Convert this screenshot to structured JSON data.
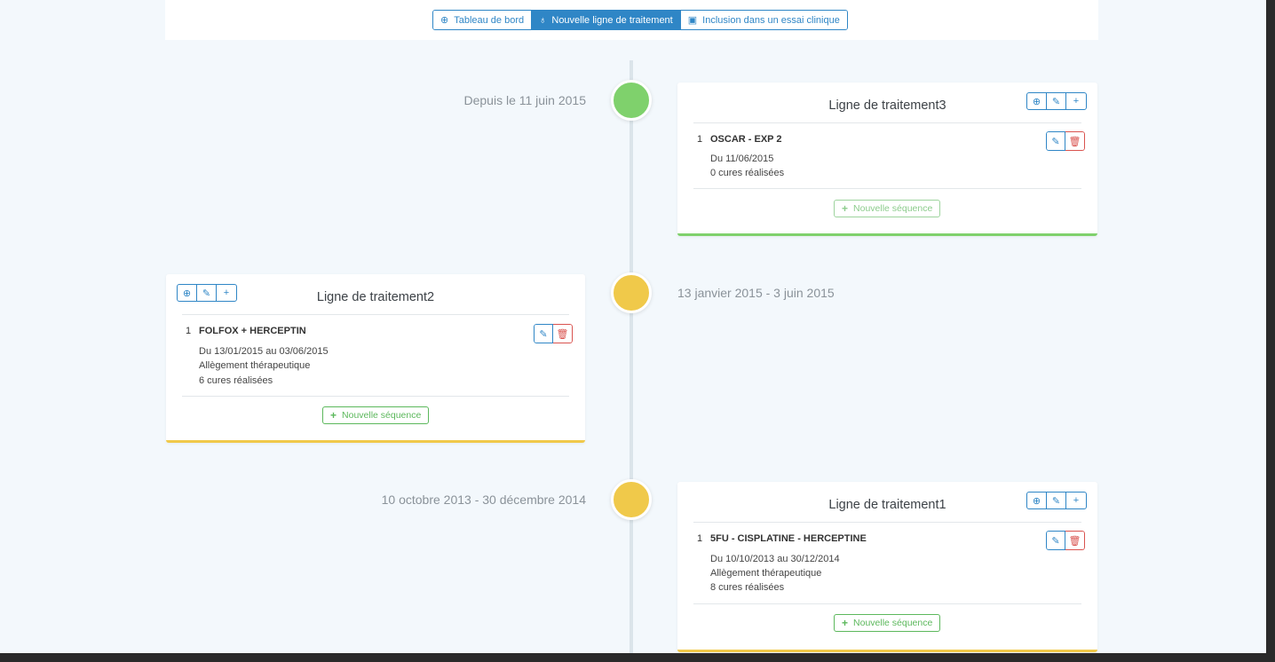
{
  "nav": {
    "tabs": [
      {
        "label": "Tableau de bord",
        "icon": "dashboard-icon"
      },
      {
        "label": "Nouvelle ligne de traitement",
        "icon": "stethoscope-icon"
      },
      {
        "label": "Inclusion dans un essai clinique",
        "icon": "medkit-icon"
      }
    ],
    "active_tab": 1
  },
  "timeline": [
    {
      "date": "Depuis le 11 juin 2015",
      "status_color": "#7fd16c",
      "title": "Ligne de traitement3",
      "sequences": [
        {
          "index": "1",
          "name": "OSCAR - EXP 2",
          "lines": [
            "Du 11/06/2015",
            "0 cures réalisées"
          ]
        }
      ],
      "new_sequence_label": "Nouvelle séquence"
    },
    {
      "date": "13 janvier 2015 - 3 juin 2015",
      "status_color": "#f0c94a",
      "title": "Ligne de traitement2",
      "sequences": [
        {
          "index": "1",
          "name": "FOLFOX + HERCEPTIN",
          "lines": [
            "Du 13/01/2015 au 03/06/2015",
            "Allègement thérapeutique",
            "6 cures réalisées"
          ]
        }
      ],
      "new_sequence_label": "Nouvelle séquence"
    },
    {
      "date": "10 octobre 2013 - 30 décembre 2014",
      "status_color": "#f0c94a",
      "title": "Ligne de traitement1",
      "sequences": [
        {
          "index": "1",
          "name": "5FU - CISPLATINE - HERCEPTINE",
          "lines": [
            "Du 10/10/2013 au 30/12/2014",
            "Allègement thérapeutique",
            "8 cures réalisées"
          ]
        }
      ],
      "new_sequence_label": "Nouvelle séquence"
    }
  ],
  "colors": {
    "primary": "#2f86c6",
    "danger": "#d9534f",
    "success": "#5cb85c"
  }
}
